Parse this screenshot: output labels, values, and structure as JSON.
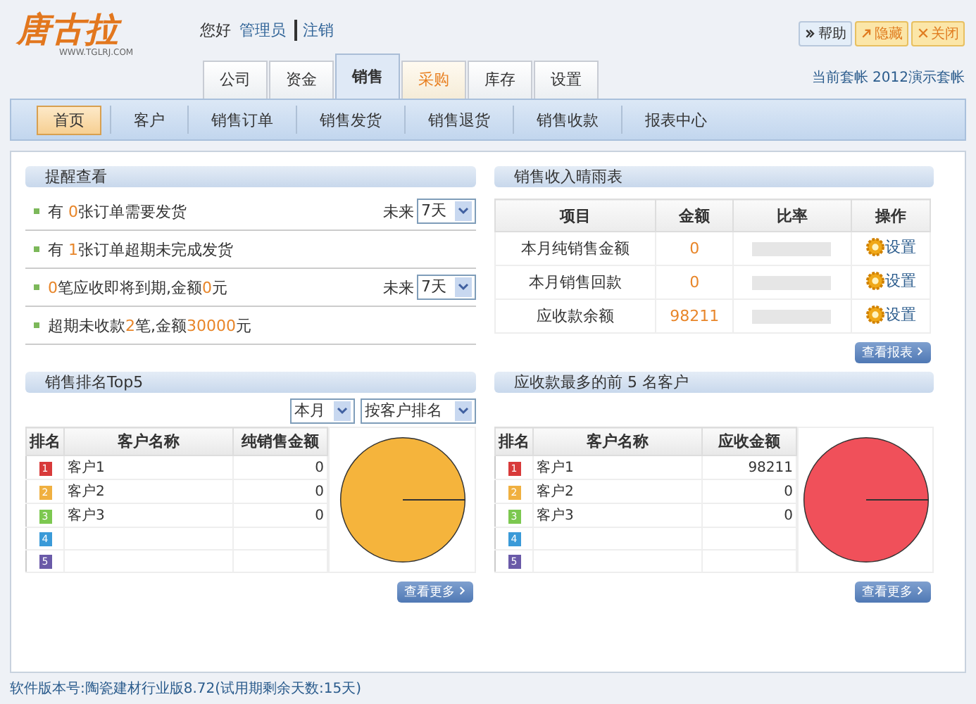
{
  "logo": {
    "name": "唐古拉",
    "url": "WWW.TGLRJ.COM"
  },
  "user": {
    "greeting": "您好",
    "name": "管理员",
    "logout": "注销"
  },
  "top_buttons": [
    {
      "label": "帮助",
      "kind": "help"
    },
    {
      "label": "隐藏",
      "kind": "hide"
    },
    {
      "label": "关闭",
      "kind": "close"
    }
  ],
  "account": "当前套帐 2012演示套帐",
  "tabs": [
    {
      "label": "公司",
      "selected": false,
      "highlighted": false
    },
    {
      "label": "资金",
      "selected": false,
      "highlighted": false
    },
    {
      "label": "销售",
      "selected": true,
      "highlighted": false
    },
    {
      "label": "采购",
      "selected": false,
      "highlighted": true
    },
    {
      "label": "库存",
      "selected": false,
      "highlighted": false
    },
    {
      "label": "设置",
      "selected": false,
      "highlighted": false
    }
  ],
  "subnav": [
    {
      "label": "首页",
      "selected": true
    },
    {
      "label": "客户",
      "selected": false
    },
    {
      "label": "销售订单",
      "selected": false
    },
    {
      "label": "销售发货",
      "selected": false
    },
    {
      "label": "销售退货",
      "selected": false
    },
    {
      "label": "销售收款",
      "selected": false
    },
    {
      "label": "报表中心",
      "selected": false
    }
  ],
  "reminders": {
    "title": "提醒查看",
    "items": [
      {
        "segments": [
          {
            "text": "有 ",
            "kind": "plain"
          },
          {
            "text": "0",
            "kind": "number"
          },
          {
            "text": "张订单需要发货",
            "kind": "plain"
          }
        ],
        "filter_label": "未来",
        "filter_value": "7天"
      },
      {
        "segments": [
          {
            "text": "有 ",
            "kind": "plain"
          },
          {
            "text": "1",
            "kind": "number"
          },
          {
            "text": "张订单超期未完成发货",
            "kind": "plain"
          }
        ]
      },
      {
        "segments": [
          {
            "text": "0",
            "kind": "number"
          },
          {
            "text": "笔应收即将到期,金额",
            "kind": "plain"
          },
          {
            "text": "0",
            "kind": "number"
          },
          {
            "text": "元",
            "kind": "plain"
          }
        ],
        "filter_label": "未来",
        "filter_value": "7天"
      },
      {
        "segments": [
          {
            "text": "超期未收款",
            "kind": "plain"
          },
          {
            "text": "2",
            "kind": "number"
          },
          {
            "text": "笔,金额",
            "kind": "plain"
          },
          {
            "text": "30000",
            "kind": "number"
          },
          {
            "text": "元",
            "kind": "plain"
          }
        ]
      }
    ]
  },
  "income": {
    "title": "销售收入晴雨表",
    "columns": [
      "项目",
      "金额",
      "比率",
      "操作"
    ],
    "rows": [
      {
        "item": "本月纯销售金额",
        "amount": "0",
        "level": 0,
        "action": "设置"
      },
      {
        "item": "本月销售回款",
        "amount": "0",
        "level": 0,
        "action": "设置"
      },
      {
        "item": "应收款余额",
        "amount": "98211",
        "level": 0,
        "action": "设置"
      }
    ],
    "more": "查看报表"
  },
  "rankings": [
    {
      "title": "销售排名Top5",
      "filters": [
        "本月",
        "按客户排名"
      ],
      "columns": [
        "排名",
        "客户名称",
        "纯销售金额"
      ],
      "color": "#f5b43c",
      "more": "查看更多",
      "rows": [
        {
          "rank": "1",
          "color": "#d83a3a",
          "name": "客户1",
          "value": "0"
        },
        {
          "rank": "2",
          "color": "#f0b040",
          "name": "客户2",
          "value": "0"
        },
        {
          "rank": "3",
          "color": "#7cc850",
          "name": "客户3",
          "value": "0"
        },
        {
          "rank": "4",
          "color": "#3a9ad8",
          "name": "",
          "value": ""
        },
        {
          "rank": "5",
          "color": "#6a5aa8",
          "name": "",
          "value": ""
        }
      ]
    },
    {
      "title": "应收款最多的前 5 名客户",
      "columns": [
        "排名",
        "客户名称",
        "应收金额"
      ],
      "color": "#f0505a",
      "more": "查看更多",
      "rows": [
        {
          "rank": "1",
          "color": "#d83a3a",
          "name": "客户1",
          "value": "98211"
        },
        {
          "rank": "2",
          "color": "#f0b040",
          "name": "客户2",
          "value": "0"
        },
        {
          "rank": "3",
          "color": "#7cc850",
          "name": "客户3",
          "value": "0"
        },
        {
          "rank": "4",
          "color": "#3a9ad8",
          "name": "",
          "value": ""
        },
        {
          "rank": "5",
          "color": "#6a5aa8",
          "name": "",
          "value": ""
        }
      ]
    }
  ],
  "status_bar": "软件版本号:陶瓷建材行业版8.72(试用期剩余天数:15天)"
}
